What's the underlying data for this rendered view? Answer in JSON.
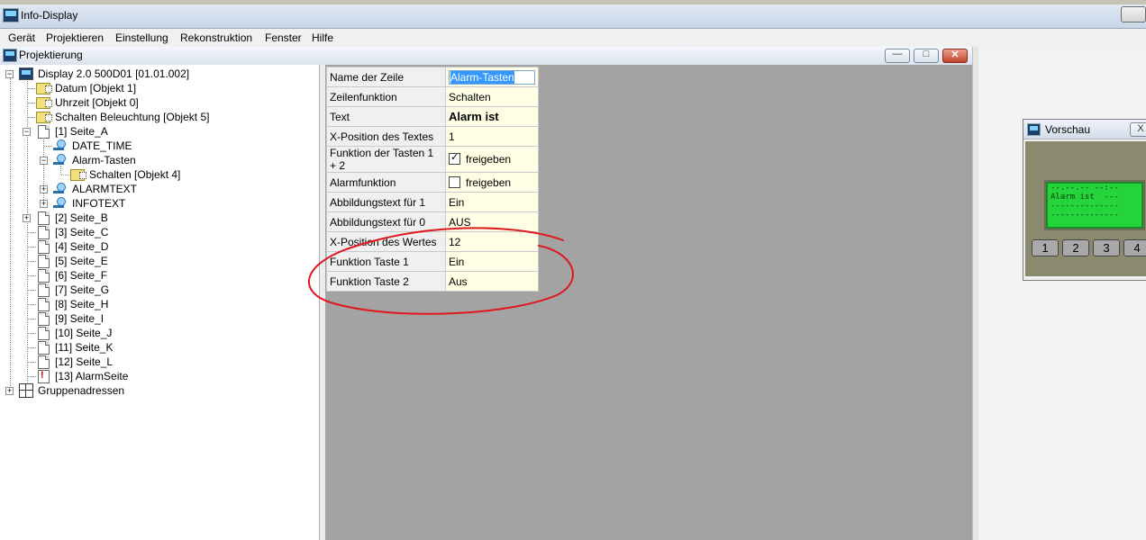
{
  "window": {
    "title": "Info-Display"
  },
  "menu": [
    "Gerät",
    "Projektieren",
    "Einstellung",
    "Rekonstruktion",
    "Fenster",
    "Hilfe"
  ],
  "child_window": {
    "title": "Projektierung",
    "buttons": [
      "—",
      "□",
      "✕"
    ]
  },
  "tree": {
    "root": "Display 2.0 500D01 [01.01.002]",
    "objects": [
      "Datum [Objekt 1]",
      "Uhrzeit [Objekt 0]",
      "Schalten Beleuchtung [Objekt 5]"
    ],
    "page_a": "[1] Seite_A",
    "page_a_lines": [
      "DATE_TIME",
      "Alarm-Tasten",
      "ALARMTEXT",
      "INFOTEXT"
    ],
    "alarm_child": "Schalten [Objekt 4]",
    "pages": [
      "[2] Seite_B",
      "[3] Seite_C",
      "[4] Seite_D",
      "[5] Seite_E",
      "[6] Seite_F",
      "[7] Seite_G",
      "[8] Seite_H",
      "[9] Seite_I",
      "[10] Seite_J",
      "[11] Seite_K",
      "[12] Seite_L",
      "[13] AlarmSeite"
    ],
    "groups": "Gruppenadressen"
  },
  "properties": {
    "rows": [
      {
        "key": "Name der Zeile",
        "value": "Alarm-Tasten"
      },
      {
        "key": "Zeilenfunktion",
        "value": "Schalten"
      },
      {
        "key": "Text",
        "value": "Alarm ist"
      },
      {
        "key": "X-Position des Textes",
        "value": "1"
      },
      {
        "key": "Funktion der Tasten 1 + 2",
        "value": "freigeben"
      },
      {
        "key": "Alarmfunktion",
        "value": "freigeben"
      },
      {
        "key": "Abbildungstext für 1",
        "value": "Ein"
      },
      {
        "key": "Abbildungstext für 0",
        "value": "AUS"
      },
      {
        "key": "X-Position des Wertes",
        "value": "12"
      },
      {
        "key": "Funktion Taste 1",
        "value": "Ein"
      },
      {
        "key": "Funktion Taste 2",
        "value": "Aus"
      }
    ],
    "checkbox_states": {
      "funktion_tasten": true,
      "alarmfunktion": false
    }
  },
  "preview": {
    "title": "Vorschau",
    "close": "X",
    "lcd_lines": [
      "--.--.-- --:--",
      "Alarm ist  ---",
      "--------------",
      "--------------"
    ],
    "keys": [
      "1",
      "2",
      "3",
      "4"
    ]
  },
  "colors": {
    "lcd": "#25d33b",
    "annotation": "#e0181e",
    "workspace": "#a3a3a3"
  }
}
